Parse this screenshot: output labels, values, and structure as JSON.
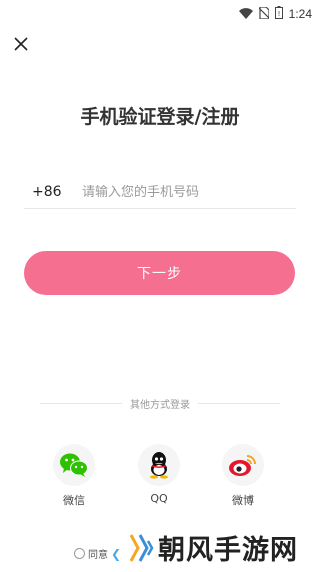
{
  "status_bar": {
    "time": "1:24",
    "icons": [
      "wifi-icon",
      "no-sim-icon",
      "battery-icon"
    ]
  },
  "header": {
    "close_icon": "close-icon"
  },
  "page": {
    "title": "手机验证登录/注册"
  },
  "phone": {
    "country_code": "+86",
    "placeholder": "请输入您的手机号码",
    "value": ""
  },
  "next_button": {
    "label": "下一步",
    "color": "#f56f91"
  },
  "other_login": {
    "label": "其他方式登录",
    "options": [
      {
        "label": "微信",
        "icon": "wechat-icon",
        "color": "#2dc100"
      },
      {
        "label": "QQ",
        "icon": "qq-icon",
        "color": "#111111"
      },
      {
        "label": "微博",
        "icon": "weibo-icon",
        "color": "#e6162d"
      }
    ]
  },
  "agreement": {
    "label": "同意"
  },
  "watermark": {
    "text": "朝风手游网"
  }
}
